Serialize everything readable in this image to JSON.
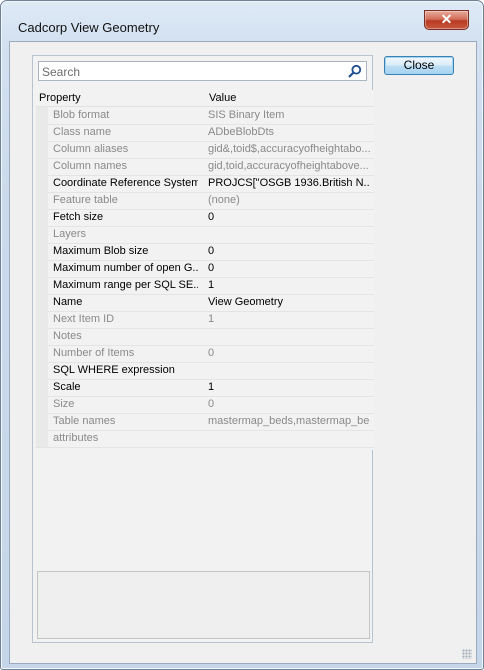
{
  "window": {
    "title": "Cadcorp View Geometry",
    "close_glyph": "✕"
  },
  "search": {
    "placeholder": "Search",
    "icon": "search-icon"
  },
  "buttons": {
    "close_label": "Close"
  },
  "grid": {
    "headers": {
      "property": "Property",
      "value": "Value"
    },
    "rows": [
      {
        "property": "Blob format",
        "value": "SIS Binary Item",
        "readonly": true
      },
      {
        "property": "Class name",
        "value": "ADbeBlobDts",
        "readonly": true
      },
      {
        "property": "Column aliases",
        "value": "gid&,toid$,accuracyofheightabo...",
        "readonly": true
      },
      {
        "property": "Column names",
        "value": "gid,toid,accuracyofheightabove...",
        "readonly": true
      },
      {
        "property": "Coordinate Reference System",
        "value": "PROJCS[\"OSGB 1936.British N...",
        "readonly": false
      },
      {
        "property": "Feature table",
        "value": "(none)",
        "readonly": true
      },
      {
        "property": "Fetch size",
        "value": "0",
        "readonly": false
      },
      {
        "property": "Layers",
        "value": "",
        "readonly": true
      },
      {
        "property": "Maximum Blob size",
        "value": "0",
        "readonly": false
      },
      {
        "property": "Maximum number of open G...",
        "value": "0",
        "readonly": false
      },
      {
        "property": "Maximum range per SQL SE...",
        "value": "1",
        "readonly": false
      },
      {
        "property": "Name",
        "value": "View Geometry",
        "readonly": false
      },
      {
        "property": "Next Item ID",
        "value": "1",
        "readonly": true
      },
      {
        "property": "Notes",
        "value": "",
        "readonly": true
      },
      {
        "property": "Number of Items",
        "value": "0",
        "readonly": true
      },
      {
        "property": "SQL WHERE expression",
        "value": "",
        "readonly": false
      },
      {
        "property": "Scale",
        "value": "1",
        "readonly": false
      },
      {
        "property": "Size",
        "value": "0",
        "readonly": true
      },
      {
        "property": "Table names",
        "value": "mastermap_beds,mastermap_be...",
        "readonly": true
      },
      {
        "property": "attributes",
        "value": "",
        "readonly": true
      }
    ]
  }
}
